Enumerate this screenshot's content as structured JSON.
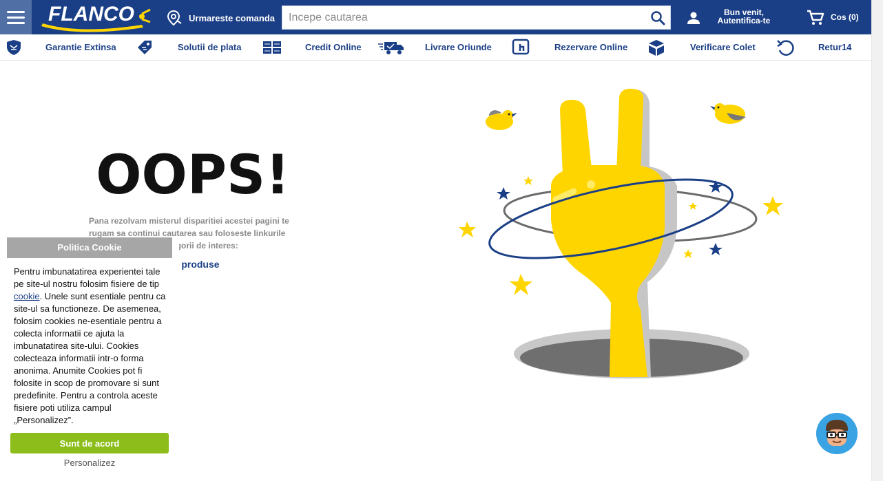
{
  "header": {
    "logo_text": "FLANCO",
    "track_order_label": "Urmareste comanda",
    "search_placeholder": "Incepe cautarea",
    "account_greeting": "Bun venit,",
    "account_action": "Autentifica-te",
    "cart_label": "Cos (0)"
  },
  "services": [
    {
      "label": "Garantie Extinsa",
      "icon": "shield-icon"
    },
    {
      "label": "Solutii de plata",
      "icon": "card-tag-icon"
    },
    {
      "label": "Credit Online",
      "icon": "money-stack-icon"
    },
    {
      "label": "Livrare Oriunde",
      "icon": "delivery-truck-icon"
    },
    {
      "label": "Rezervare Online",
      "icon": "touch-reserve-icon"
    },
    {
      "label": "Verificare Colet",
      "icon": "package-box-icon"
    },
    {
      "label": "Retur14",
      "icon": "return-arrow-icon"
    }
  ],
  "error": {
    "title": "OOPS!",
    "message": "Pana rezolvam misterul disparitiei acestei pagini te rugam sa continui cautarea sau foloseste linkurile de mai jos pentru categorii de interes:",
    "link_label": "Toate categoriile de produse"
  },
  "cookie": {
    "title": "Politica Cookie",
    "text_before_link": "Pentru imbunatatirea experientei tale pe site-ul nostru folosim fisiere de tip ",
    "link_text": "cookie",
    "text_after_link": ". Unele sunt esentiale pentru ca site-ul sa functioneze. De asemenea, folosim cookies ne-esentiale pentru a colecta informatii ce ajuta la imbunatatirea site-ului. Cookies colecteaza informatii intr-o forma anonima. Anumite Cookies pot fi folosite in scop de promovare si sunt predefinite. Pentru a controla aceste fisiere poti utiliza campul „Personalizez”.",
    "accept_label": "Sunt de acord",
    "personalize_label": "Personalizez"
  },
  "colors": {
    "brand_blue": "#1b3f86",
    "brand_yellow": "#ffd500",
    "accept_green": "#8cbd1a",
    "cookie_title_grey": "#a6a6a6"
  }
}
